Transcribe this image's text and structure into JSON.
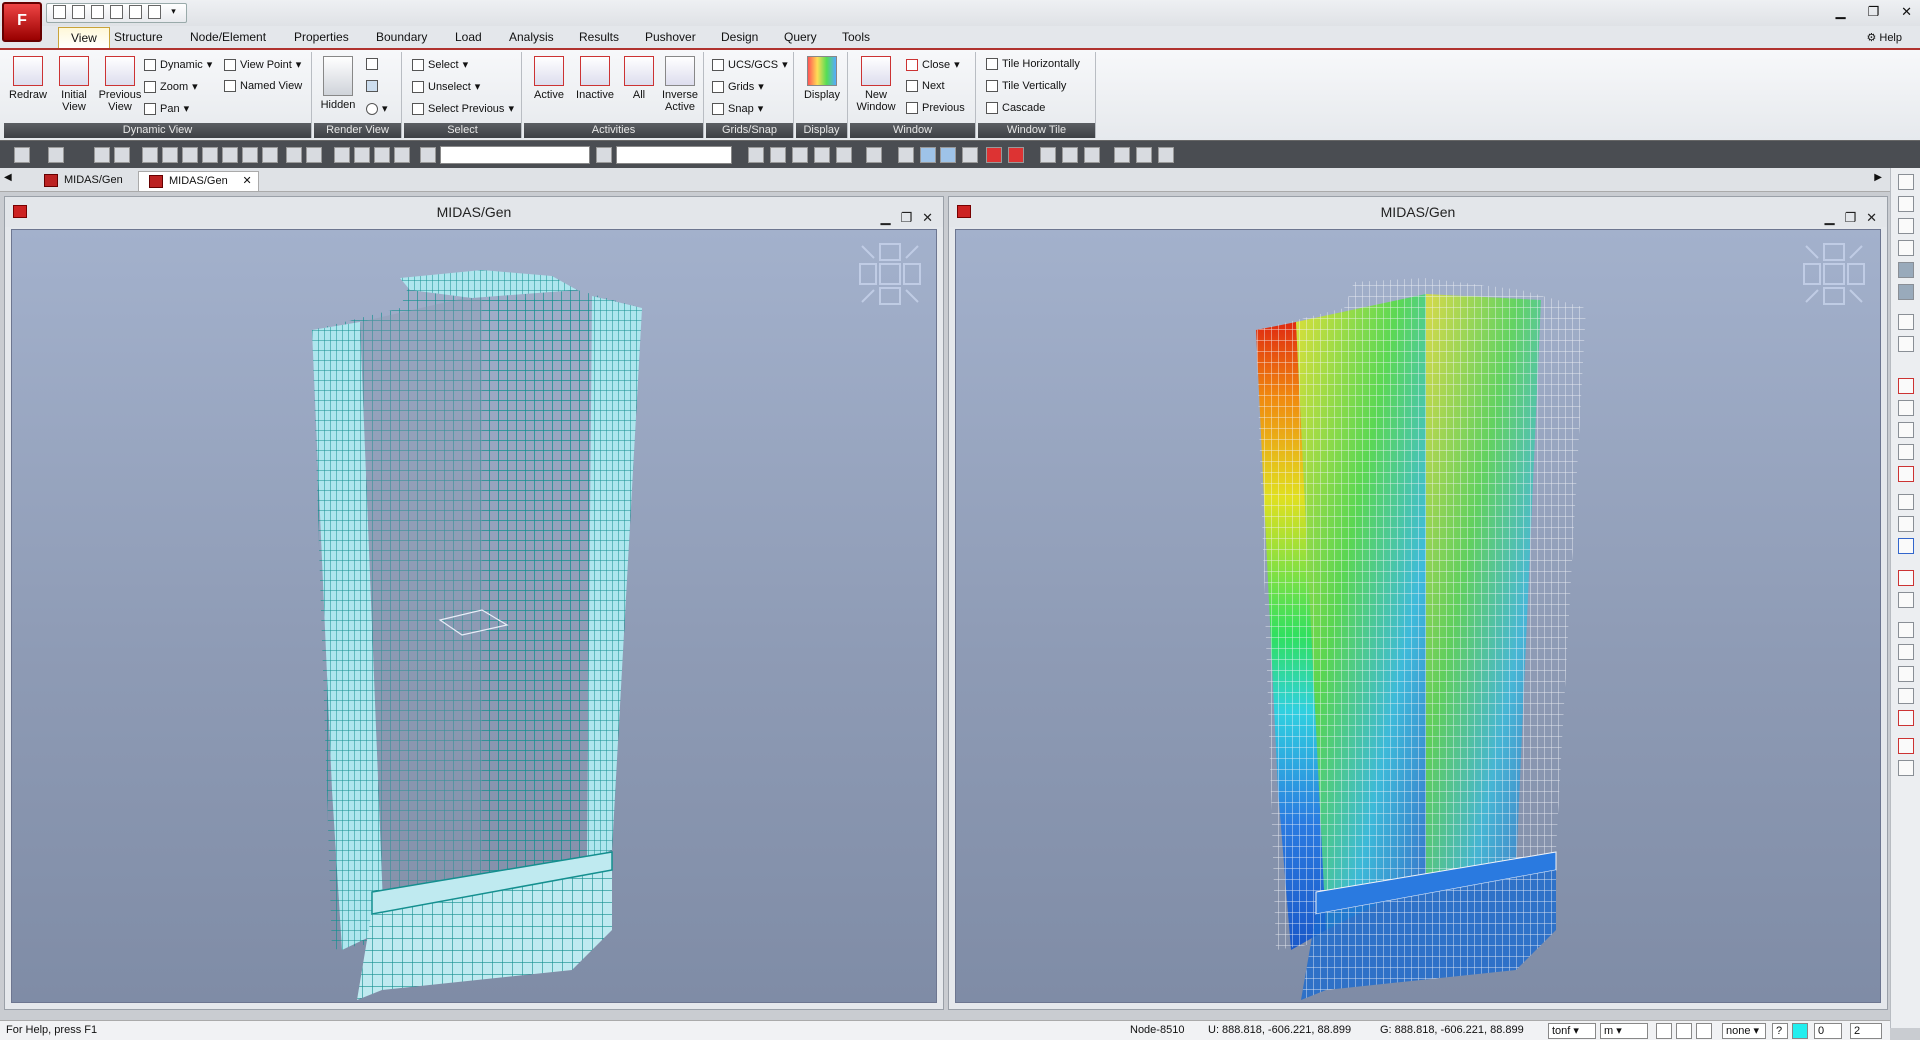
{
  "app": {
    "logo_text": "F",
    "window_controls": [
      "▁",
      "❐",
      "✕"
    ]
  },
  "ribbon_tabs": [
    "View",
    "Structure",
    "Node/Element",
    "Properties",
    "Boundary",
    "Load",
    "Analysis",
    "Results",
    "Pushover",
    "Design",
    "Query",
    "Tools"
  ],
  "help_label": "Help",
  "groups": {
    "dynamic_view": {
      "label": "Dynamic View",
      "redraw": "Redraw",
      "initial_view": "Initial View",
      "previous_view": "Previous View",
      "dynamic": "Dynamic",
      "zoom": "Zoom",
      "pan": "Pan",
      "view_point": "View Point",
      "named_view": "Named View"
    },
    "render_view": {
      "label": "Render View",
      "hidden": "Hidden"
    },
    "select": {
      "label": "Select",
      "select": "Select",
      "unselect": "Unselect",
      "select_previous": "Select Previous"
    },
    "activities": {
      "label": "Activities",
      "active": "Active",
      "inactive": "Inactive",
      "all": "All",
      "inverse_active": "Inverse Active"
    },
    "grids_snap": {
      "label": "Grids/Snap",
      "ucs": "UCS/GCS",
      "grids": "Grids",
      "snap": "Snap"
    },
    "display": {
      "label": "Display",
      "display": "Display"
    },
    "window": {
      "label": "Window",
      "new_window": "New Window",
      "close": "Close",
      "next": "Next",
      "previous": "Previous"
    },
    "window_tile": {
      "label": "Window Tile",
      "tile_h": "Tile Horizontally",
      "tile_v": "Tile Vertically",
      "cascade": "Cascade"
    }
  },
  "doc_tabs": [
    "MIDAS/Gen",
    "MIDAS/Gen"
  ],
  "viewports": [
    {
      "title": "MIDAS/Gen"
    },
    {
      "title": "MIDAS/Gen"
    }
  ],
  "status": {
    "help": "For Help, press F1",
    "node": "Node-8510",
    "ucs_coord": "U: 888.818, -606.221, 88.899",
    "gcs_coord": "G: 888.818, -606.221, 88.899",
    "force_unit": "tonf",
    "length_unit": "m",
    "none": "none",
    "num1": "0",
    "num2": "2"
  },
  "colors": {
    "accent": "#b0332f",
    "model_wire": "#148f8f",
    "model_fill": "#aee6ee"
  }
}
